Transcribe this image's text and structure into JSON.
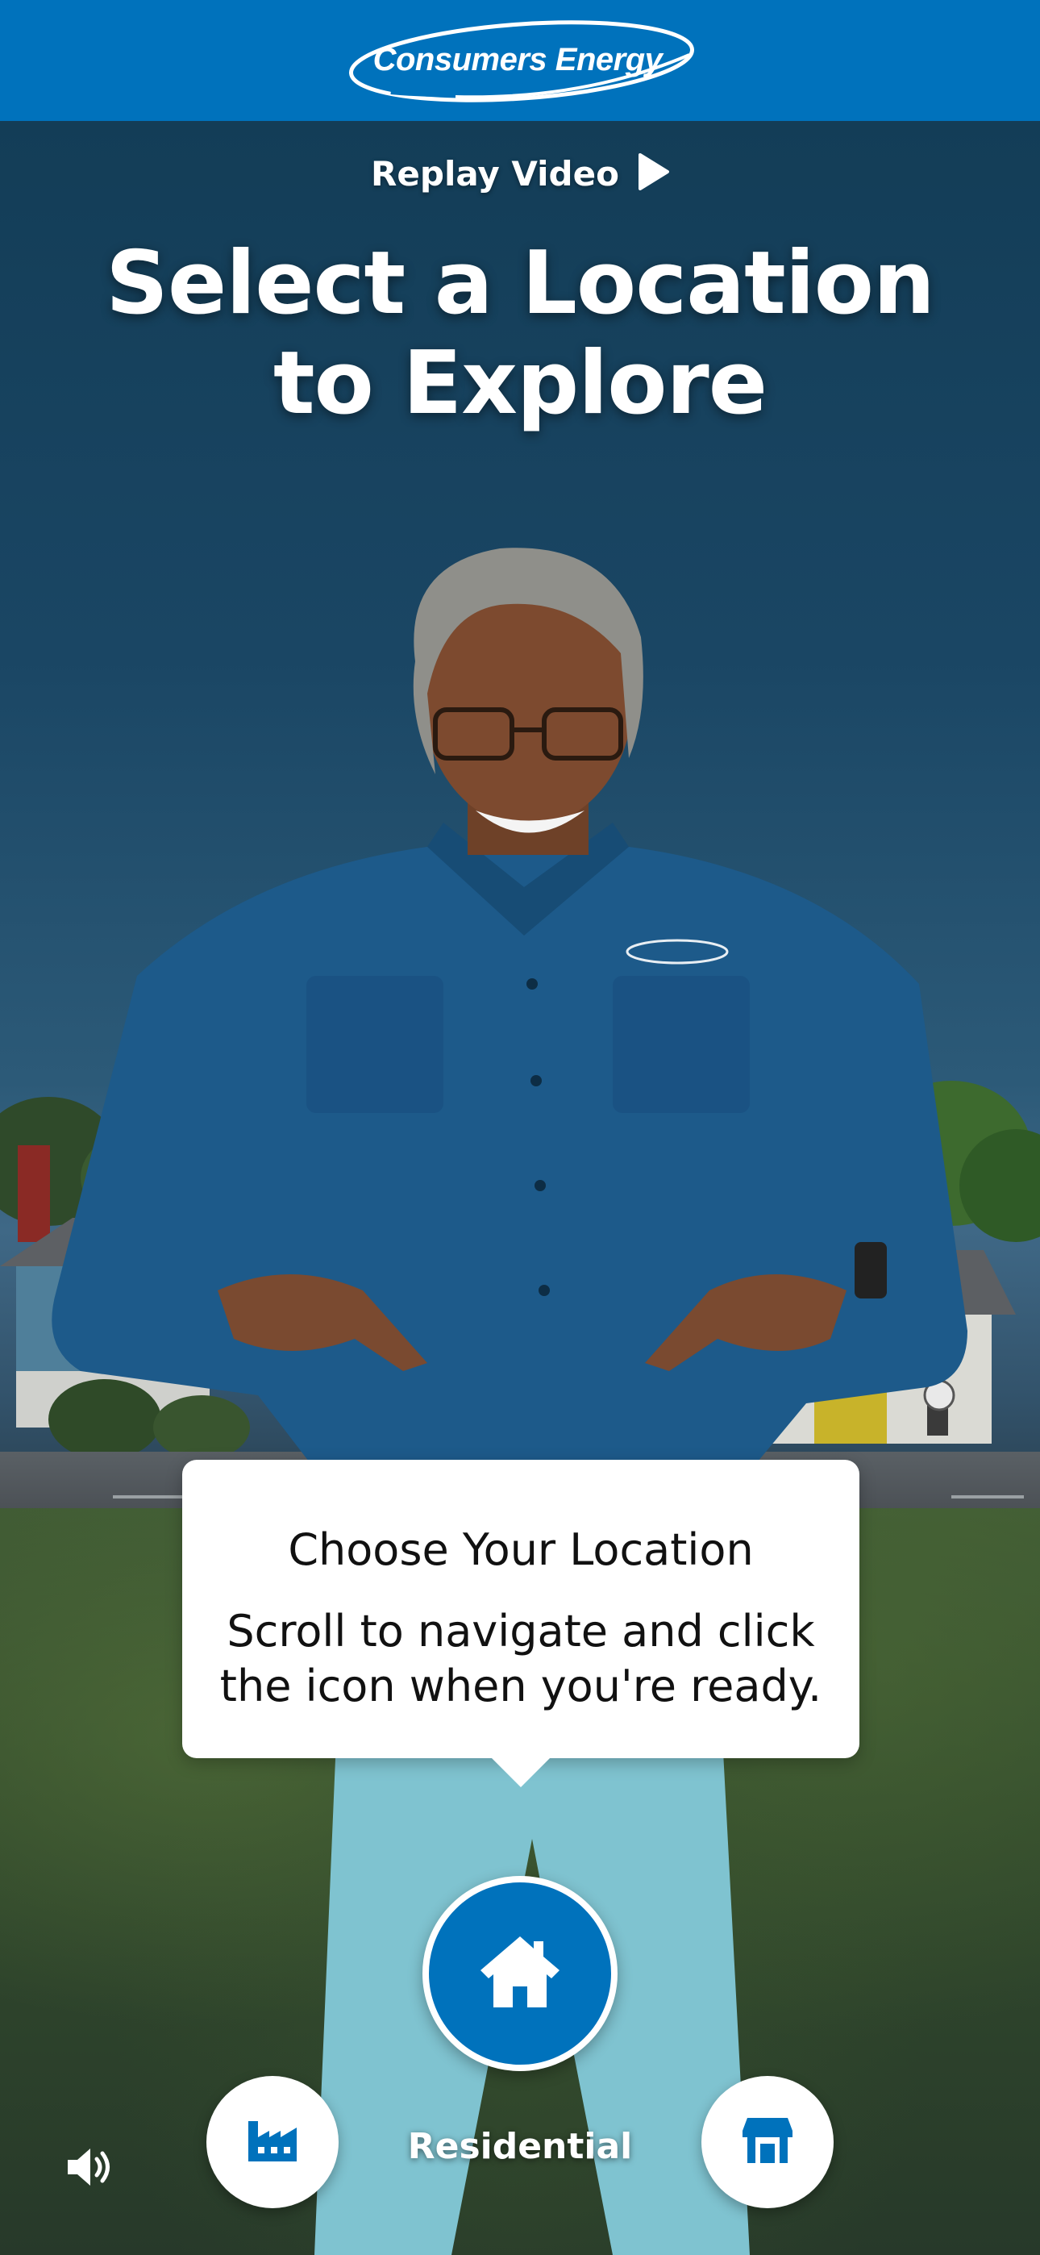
{
  "header": {
    "logo_text": "Consumers Energy"
  },
  "replay": {
    "label": "Replay Video",
    "icon": "play-icon"
  },
  "title": {
    "line1": "Select a Location",
    "line2": "to Explore"
  },
  "tooltip": {
    "title": "Choose Your Location",
    "body": "Scroll to navigate and click the icon when you're ready."
  },
  "nav": {
    "selected_label": "Residential",
    "selected_icon": "house-icon",
    "left_icon": "factory-icon",
    "right_icon": "store-icon",
    "sound_icon": "speaker-icon"
  },
  "colors": {
    "brand_blue": "#0072bc",
    "white": "#ffffff"
  }
}
